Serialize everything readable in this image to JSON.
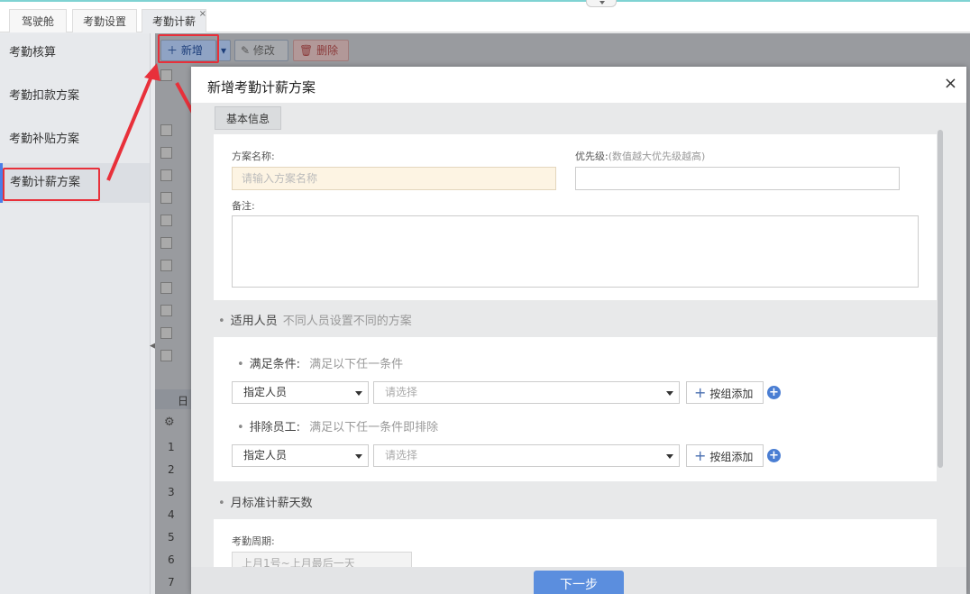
{
  "window": {
    "tabs": [
      {
        "label": "驾驶舱"
      },
      {
        "label": "考勤设置"
      },
      {
        "label": "考勤计薪",
        "close": "×"
      }
    ]
  },
  "sidebar": {
    "items": [
      {
        "label": "考勤核算"
      },
      {
        "label": "考勤扣款方案"
      },
      {
        "label": "考勤补贴方案"
      },
      {
        "label": "考勤计薪方案",
        "active": true
      }
    ]
  },
  "toolbar": {
    "add_label": "新增",
    "edit_label": "修改",
    "delete_label": "删除"
  },
  "background_table": {
    "row_numbers": [
      "1",
      "2",
      "3",
      "4",
      "5",
      "6",
      "7"
    ],
    "subheader_label": "日"
  },
  "modal": {
    "title": "新增考勤计薪方案",
    "close": "×",
    "tab_basic": "基本信息",
    "basic": {
      "name_label": "方案名称:",
      "name_placeholder": "请输入方案名称",
      "priority_label": "优先级:",
      "priority_hint": "(数值越大优先级越高)",
      "remark_label": "备注:"
    },
    "applicable": {
      "title": "适用人员",
      "subtitle": "不同人员设置不同的方案",
      "include_label": "满足条件:",
      "include_hint": "满足以下任一条件",
      "include_type": "指定人员",
      "include_select_placeholder": "请选择",
      "include_group_btn": "按组添加",
      "exclude_label": "排除员工:",
      "exclude_hint": "满足以下任一条件即排除",
      "exclude_type": "指定人员",
      "exclude_select_placeholder": "请选择",
      "exclude_group_btn": "按组添加"
    },
    "monthly": {
      "title": "月标准计薪天数",
      "period_label": "考勤周期:",
      "period_value": "上月1号~上月最后一天"
    },
    "next_label": "下一步"
  },
  "colors": {
    "accent": "#5b8ede",
    "annotation": "#e8303a",
    "sidebar_active": "#4a7ee8"
  }
}
